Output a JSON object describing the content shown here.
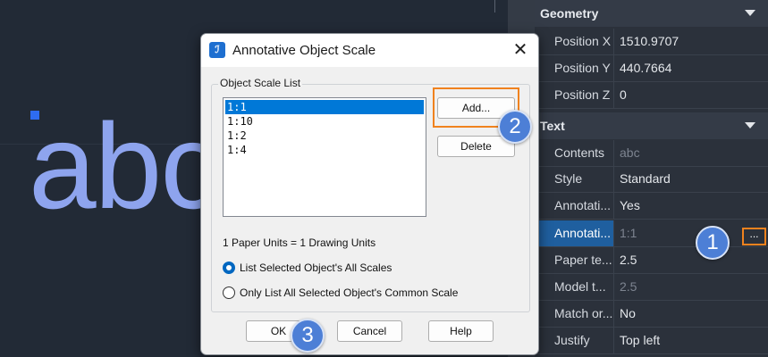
{
  "canvas": {
    "text": "abc"
  },
  "properties": {
    "sections": [
      {
        "title": "Geometry"
      },
      {
        "title": "Text"
      }
    ],
    "geometry_rows": [
      {
        "name": "Position X",
        "value": "1510.9707"
      },
      {
        "name": "Position Y",
        "value": "440.7664"
      },
      {
        "name": "Position Z",
        "value": "0"
      }
    ],
    "text_rows": [
      {
        "name": "Contents",
        "value": "abc"
      },
      {
        "name": "Style",
        "value": "Standard"
      },
      {
        "name": "Annotati...",
        "value": "Yes"
      },
      {
        "name": "Annotati...",
        "value": "1:1"
      },
      {
        "name": "Paper te...",
        "value": "2.5"
      },
      {
        "name": "Model t...",
        "value": "2.5"
      },
      {
        "name": "Match or...",
        "value": "No"
      },
      {
        "name": "Justify",
        "value": "Top left"
      }
    ],
    "ellipsis_label": "..."
  },
  "dialog": {
    "title": "Annotative Object Scale",
    "close": "✕",
    "group_label": "Object Scale List",
    "scales": [
      "1:1",
      "1:10",
      "1:2",
      "1:4"
    ],
    "selected_index": 0,
    "add_label": "Add...",
    "delete_label": "Delete",
    "units_text": "1 Paper Units = 1 Drawing Units",
    "radio_all": "List Selected Object's All Scales",
    "radio_common": "Only List All Selected Object's Common Scale",
    "ok_label": "OK",
    "cancel_label": "Cancel",
    "help_label": "Help"
  },
  "badges": [
    "1",
    "2",
    "3"
  ],
  "colors": {
    "accent": "#f0821e",
    "badge": "#4d7fd6",
    "selection": "#0078d7"
  }
}
